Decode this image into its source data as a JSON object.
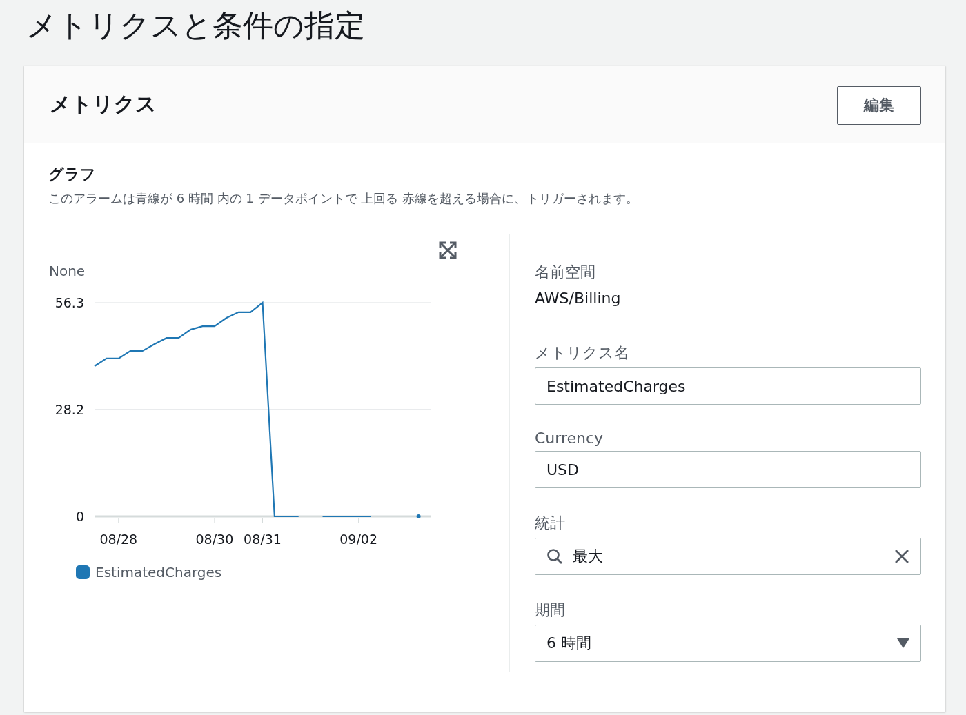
{
  "page_title": "メトリクスと条件の指定",
  "panel": {
    "title": "メトリクス",
    "edit_button": "編集",
    "graph": {
      "heading": "グラフ",
      "description": "このアラームは青線が 6 時間 内の 1 データポイントで 上回る 赤線を超える場合に、トリガーされます。",
      "chart_data": {
        "type": "line",
        "ylabel": "None",
        "categories": [
          null,
          null,
          "08/28",
          null,
          null,
          null,
          null,
          null,
          null,
          null,
          "08/30",
          null,
          null,
          null,
          "08/31",
          null,
          null,
          null,
          null,
          null,
          null,
          null,
          "09/02",
          null,
          null,
          null,
          null,
          null
        ],
        "series": [
          {
            "name": "EstimatedCharges",
            "color": "#1f77b4",
            "values": [
              39.6,
              41.6,
              41.6,
              43.6,
              43.6,
              45.4,
              47.0,
              47.0,
              49.2,
              50.1,
              50.1,
              52.3,
              53.8,
              53.8,
              56.3,
              0,
              0,
              0,
              null,
              0,
              0,
              0,
              0,
              0,
              null,
              null,
              null,
              0
            ]
          }
        ],
        "ylim": [
          0,
          56.3
        ],
        "yticks": [
          0,
          28.2,
          56.3
        ]
      }
    },
    "fields": [
      {
        "kind": "static",
        "label": "名前空間",
        "value": "AWS/Billing"
      },
      {
        "kind": "input",
        "label": "メトリクス名",
        "value": "EstimatedCharges"
      },
      {
        "kind": "input",
        "label": "Currency",
        "value": "USD"
      },
      {
        "kind": "search",
        "label": "統計",
        "value": "最大"
      },
      {
        "kind": "select",
        "label": "期間",
        "value": "6 時間"
      }
    ]
  }
}
